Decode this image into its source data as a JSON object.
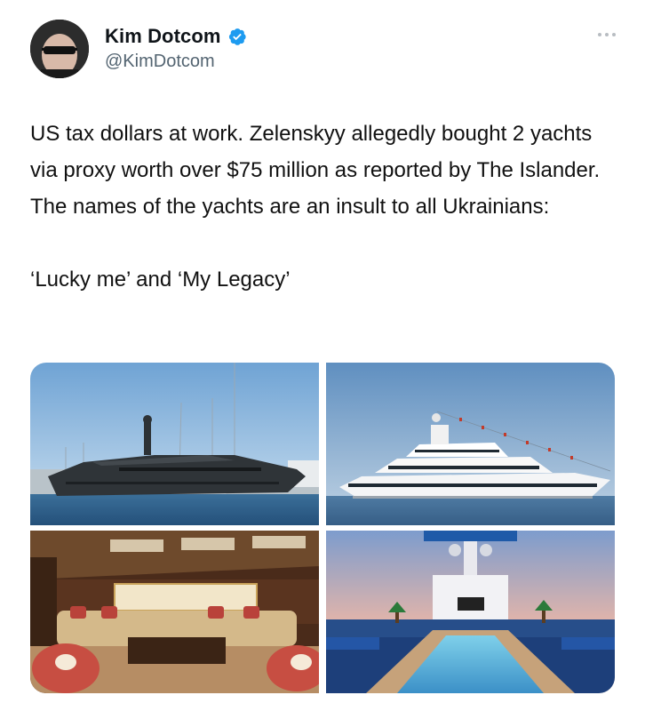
{
  "author": {
    "display_name": "Kim Dotcom",
    "handle": "@KimDotcom",
    "verified": true,
    "verified_color": "#1d9bf0"
  },
  "more_icon": "more-horizontal-icon",
  "tweet": {
    "paragraphs": [
      "US tax dollars at work. Zelenskyy allegedly bought 2 yachts via proxy worth over $75 million as reported by The Islander. The names of the yachts are an insult to all Ukrainians:",
      "‘Lucky me’ and ‘My Legacy’"
    ]
  },
  "media": [
    {
      "kind": "photo",
      "subject": "dark-grey-yacht-in-marina"
    },
    {
      "kind": "photo",
      "subject": "white-yacht-with-flags"
    },
    {
      "kind": "photo",
      "subject": "ornate-yacht-salon-interior"
    },
    {
      "kind": "photo",
      "subject": "yacht-deck-pool-at-dusk"
    }
  ]
}
